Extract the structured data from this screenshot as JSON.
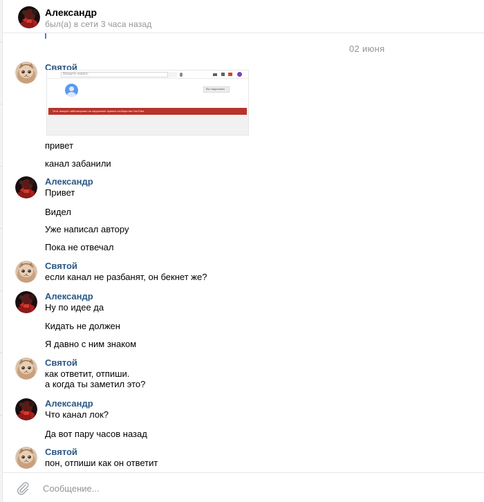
{
  "header": {
    "name": "Александр",
    "status": "был(а) в сети 3 часа назад"
  },
  "date_separator": "02 июня",
  "screenshot_preview": {
    "search_placeholder": "Введите запрос",
    "subscribe_label": "Вы подписаны",
    "banner_text": "Этот аккаунт заблокирован за нарушение правил сообщества YouTube."
  },
  "messages": [
    {
      "sender": "Святой",
      "lines": [
        "привет",
        "канал забанили"
      ]
    },
    {
      "sender": "Александр",
      "lines": [
        "Привет",
        "Видел",
        "Уже написал автору",
        "Пока не отвечал"
      ]
    },
    {
      "sender": "Святой",
      "lines": [
        "если канал не разбанят, он бекнет же?"
      ]
    },
    {
      "sender": "Александр",
      "lines": [
        "Ну по идее да",
        "Кидать не должен",
        "Я давно с ним знаком"
      ]
    },
    {
      "sender": "Святой",
      "lines": [
        "как ответит, отпиши.",
        "а когда ты заметил это?"
      ]
    },
    {
      "sender": "Александр",
      "lines": [
        "Что канал лок?",
        "Да вот пару часов назад"
      ]
    },
    {
      "sender": "Святой",
      "lines": [
        "пон, отпиши как он ответит"
      ]
    }
  ],
  "composer": {
    "placeholder": "Сообщение..."
  },
  "icons": {
    "attach": "paperclip-icon",
    "avatar_alexander": "user-photo-dark-red",
    "avatar_svyatoy": "cat-photo"
  },
  "colors": {
    "sender_name": "#2a5885",
    "muted": "#939393",
    "ban_banner": "#b7342c"
  }
}
